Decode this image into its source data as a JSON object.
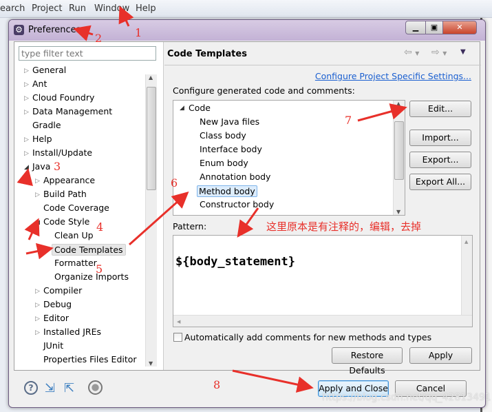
{
  "menubar": {
    "items": [
      "earch",
      "Project",
      "Run",
      "Window",
      "Help"
    ]
  },
  "dialog": {
    "title": "Preferences",
    "filter_placeholder": "type filter text",
    "tree": [
      {
        "label": "General",
        "depth": 0,
        "twisty": "collapsed"
      },
      {
        "label": "Ant",
        "depth": 0,
        "twisty": "collapsed"
      },
      {
        "label": "Cloud Foundry",
        "depth": 0,
        "twisty": "collapsed"
      },
      {
        "label": "Data Management",
        "depth": 0,
        "twisty": "collapsed"
      },
      {
        "label": "Gradle",
        "depth": 0,
        "twisty": "none"
      },
      {
        "label": "Help",
        "depth": 0,
        "twisty": "collapsed"
      },
      {
        "label": "Install/Update",
        "depth": 0,
        "twisty": "collapsed"
      },
      {
        "label": "Java",
        "depth": 0,
        "twisty": "expanded"
      },
      {
        "label": "Appearance",
        "depth": 1,
        "twisty": "collapsed"
      },
      {
        "label": "Build Path",
        "depth": 1,
        "twisty": "collapsed"
      },
      {
        "label": "Code Coverage",
        "depth": 1,
        "twisty": "none"
      },
      {
        "label": "Code Style",
        "depth": 1,
        "twisty": "expanded"
      },
      {
        "label": "Clean Up",
        "depth": 2,
        "twisty": "none"
      },
      {
        "label": "Code Templates",
        "depth": 2,
        "twisty": "none",
        "selected": true
      },
      {
        "label": "Formatter",
        "depth": 2,
        "twisty": "none"
      },
      {
        "label": "Organize Imports",
        "depth": 2,
        "twisty": "none"
      },
      {
        "label": "Compiler",
        "depth": 1,
        "twisty": "collapsed"
      },
      {
        "label": "Debug",
        "depth": 1,
        "twisty": "collapsed"
      },
      {
        "label": "Editor",
        "depth": 1,
        "twisty": "collapsed"
      },
      {
        "label": "Installed JREs",
        "depth": 1,
        "twisty": "collapsed"
      },
      {
        "label": "JUnit",
        "depth": 1,
        "twisty": "none"
      },
      {
        "label": "Properties Files Editor",
        "depth": 1,
        "twisty": "none"
      }
    ],
    "page": {
      "title": "Code Templates",
      "link": "Configure Project Specific Settings...",
      "description": "Configure generated code and comments:",
      "templates_root": "Code",
      "templates": [
        "New Java files",
        "Class body",
        "Interface body",
        "Enum body",
        "Annotation body",
        "Method body",
        "Constructor body"
      ],
      "selected_template": "Method body",
      "buttons": {
        "edit": "Edit...",
        "import": "Import...",
        "export": "Export...",
        "export_all": "Export All..."
      },
      "pattern_label": "Pattern:",
      "pattern_value": "${body_statement}",
      "auto_comments_label": "Automatically add comments for new methods and types",
      "auto_comments_checked": false,
      "restore_defaults": "Restore Defaults",
      "apply": "Apply"
    },
    "footer": {
      "apply_close": "Apply and Close",
      "cancel": "Cancel"
    }
  },
  "annotations": {
    "numbers": [
      "1",
      "2",
      "3",
      "4",
      "5",
      "6",
      "7",
      "8"
    ],
    "note": "这里原本是有注释的，编辑，去掉",
    "color": "#e8302a"
  },
  "watermark": "https://blog.csdn.net/qq_42813491"
}
